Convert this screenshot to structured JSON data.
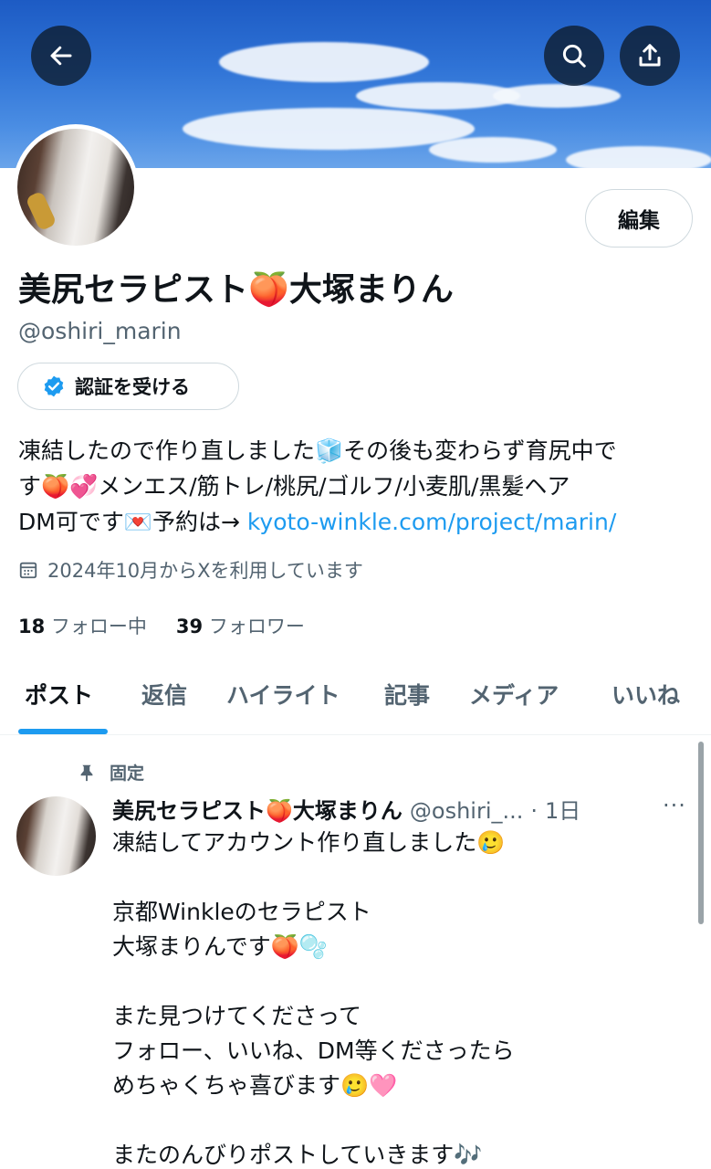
{
  "header": {
    "back_icon": "arrow-left-icon",
    "search_icon": "search-icon",
    "share_icon": "share-icon"
  },
  "profile": {
    "edit_label": "編集",
    "name": "美尻セラピスト🍑大塚まりん",
    "handle": "@oshiri_marin",
    "verify_label": "認証を受ける",
    "bio": {
      "line1": "凍結したので作り直しました🧊その後も変わらず育尻中で",
      "line2": "す🍑💞メンエス/筋トレ/桃尻/ゴルフ/小麦肌/黒髪ヘア",
      "line3_prefix": "DM可です💌予約は→ ",
      "link": "kyoto-winkle.com/project/marin/"
    },
    "joined": "2024年10月からXを利用しています",
    "following_count": "18",
    "following_label": "フォロー中",
    "followers_count": "39",
    "followers_label": "フォロワー"
  },
  "tabs": [
    {
      "label": "ポスト",
      "active": true
    },
    {
      "label": "返信",
      "active": false
    },
    {
      "label": "ハイライト",
      "active": false
    },
    {
      "label": "記事",
      "active": false
    },
    {
      "label": "メディア",
      "active": false
    },
    {
      "label": "いいね",
      "active": false
    }
  ],
  "post": {
    "pinned_label": "固定",
    "author_name": "美尻セラピスト🍑大塚まりん",
    "author_handle": "@oshiri_...",
    "separator": "·",
    "time": "1日",
    "more": "···",
    "lines": [
      "凍結してアカウント作り直しました🥲",
      "",
      "京都Winkleのセラピスト",
      "大塚まりんです🍑🫧",
      "",
      "また見つけてくださって",
      "フォロー、いいね、DM等くださったら",
      "めちゃくちゃ喜びます🥲🩷",
      "",
      "またのんびりポストしていきます🎶"
    ]
  },
  "colors": {
    "accent": "#1d9bf0",
    "text": "#0f1419",
    "secondary": "#536471"
  }
}
